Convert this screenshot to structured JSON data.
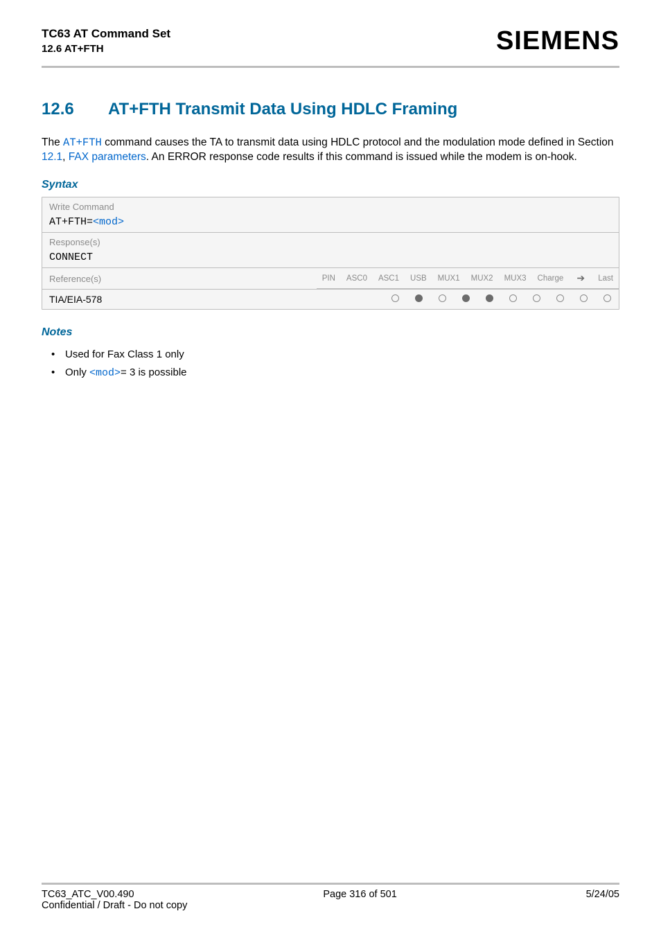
{
  "header": {
    "title": "TC63 AT Command Set",
    "subtitle": "12.6 AT+FTH",
    "brand": "SIEMENS"
  },
  "section": {
    "number": "12.6",
    "title": "AT+FTH   Transmit Data Using HDLC Framing"
  },
  "body": {
    "pre": "The ",
    "cmd": "AT+FTH",
    "mid1": " command causes the TA to transmit data using HDLC protocol and the modulation mode defined in Section ",
    "sec_ref": "12.1",
    "mid2": ", ",
    "link_text": "FAX parameters",
    "tail": ". An ERROR response code results if this command is issued while the modem is on-hook."
  },
  "syntax": {
    "heading": "Syntax",
    "write_label": "Write Command",
    "write_prefix": "AT+FTH=",
    "write_param": "<mod>",
    "response_label": "Response(s)",
    "response_value": "CONNECT",
    "references_label": "Reference(s)",
    "reference_value": "TIA/EIA-578",
    "columns": [
      "PIN",
      "ASC0",
      "ASC1",
      "USB",
      "MUX1",
      "MUX2",
      "MUX3",
      "Charge",
      "➔",
      "Last"
    ],
    "values": [
      "empty",
      "filled",
      "empty",
      "filled",
      "filled",
      "empty",
      "empty",
      "empty",
      "empty",
      "empty"
    ]
  },
  "notes": {
    "heading": "Notes",
    "items": [
      {
        "text": "Used for Fax Class 1 only"
      },
      {
        "pre": "Only ",
        "param": "<mod>",
        "post": "= 3 is possible"
      }
    ]
  },
  "footer": {
    "left": "TC63_ATC_V00.490",
    "center": "Page 316 of 501",
    "right": "5/24/05",
    "sub": "Confidential / Draft - Do not copy"
  }
}
